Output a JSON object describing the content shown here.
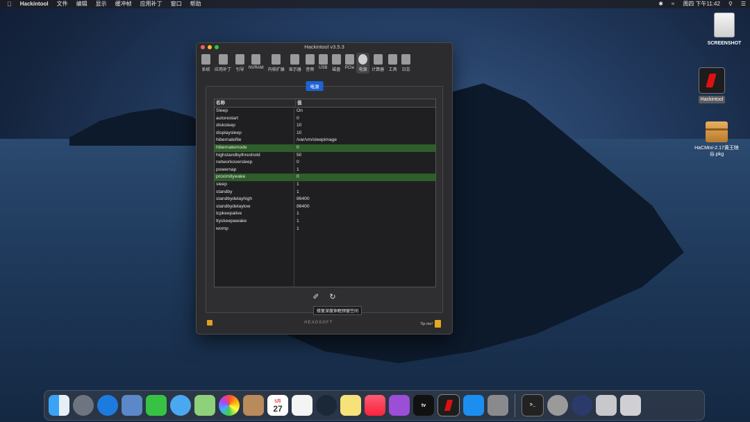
{
  "menubar": {
    "apple_icon": "apple-icon",
    "app_name": "Hackintool",
    "menus": [
      "文件",
      "编辑",
      "显示",
      "缓冲帧",
      "应用补丁",
      "窗口",
      "帮助"
    ],
    "clock": "周四 下午11:42"
  },
  "desktop": {
    "icons": [
      {
        "label": "SCREENSHOT"
      },
      {
        "label": "Hackintool"
      },
      {
        "label": "HaCMini-2.17黄王映谷.pkg"
      }
    ]
  },
  "window": {
    "title": "Hackintool v3.5.3",
    "toolbar": [
      {
        "label": "系统"
      },
      {
        "label": "应用补丁"
      },
      {
        "label": "引导"
      },
      {
        "label": "NVRAM"
      },
      {
        "label": "内核扩展"
      },
      {
        "label": "显示器"
      },
      {
        "label": "音频"
      },
      {
        "label": "USB"
      },
      {
        "label": "磁盘"
      },
      {
        "label": "PCIe"
      },
      {
        "label": "电源"
      },
      {
        "label": "计算器"
      },
      {
        "label": "工具"
      },
      {
        "label": "日志"
      }
    ],
    "active_tab": "电源",
    "section_label": "电源",
    "table": {
      "headers": [
        "名称",
        "值"
      ],
      "rows": [
        {
          "name": "Sleep",
          "value": "On"
        },
        {
          "name": "autorestart",
          "value": "0"
        },
        {
          "name": "disksleep",
          "value": "10"
        },
        {
          "name": "displaysleep",
          "value": "10"
        },
        {
          "name": "hibernatefile",
          "value": "/var/vm/sleepimage"
        },
        {
          "name": "hibernatemode",
          "value": "0"
        },
        {
          "name": "highstandbythreshold",
          "value": "50"
        },
        {
          "name": "networkoversleep",
          "value": "0"
        },
        {
          "name": "powernap",
          "value": "1"
        },
        {
          "name": "proximitywake",
          "value": "0"
        },
        {
          "name": "sleep",
          "value": "1"
        },
        {
          "name": "standby",
          "value": "1"
        },
        {
          "name": "standbydelayhigh",
          "value": "86400"
        },
        {
          "name": "standbydelaylow",
          "value": "86400"
        },
        {
          "name": "tcpkeepalive",
          "value": "1"
        },
        {
          "name": "ttyskeepawake",
          "value": "1"
        },
        {
          "name": "womp",
          "value": "1"
        }
      ]
    },
    "tooltip": "修复深度休眠预留空间",
    "footer": {
      "brand": "HEADSOFT",
      "tip": "Tip.me!"
    }
  },
  "dock": {
    "apps": [
      "Finder",
      "Launchpad",
      "Safari",
      "Mail",
      "FaceTime",
      "Messages",
      "Maps",
      "Photos",
      "Contacts",
      "Calendar",
      "Reminders",
      "Steam",
      "Notes",
      "Music",
      "Podcasts",
      "TV",
      "Hackintool",
      "App Store",
      "System Preferences",
      "Terminal",
      "Disk Utility",
      "Compressor",
      "Downloads",
      "Trash"
    ],
    "calendar_day": "27",
    "calendar_month": "5月",
    "tv_label": "tv"
  }
}
